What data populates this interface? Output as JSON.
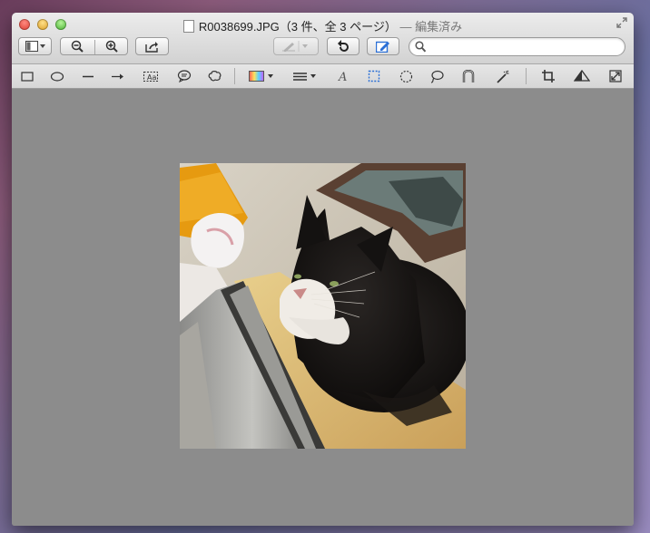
{
  "window": {
    "title_file": "R0038699.JPG",
    "title_count": "（3 件、全 3 ページ）",
    "title_status": "— 編集済み"
  },
  "toolbar": {
    "sidebar_button_icon": "sidebar-icon",
    "zoom_out_icon": "zoom-out-icon",
    "zoom_in_icon": "zoom-in-icon",
    "share_icon": "share-icon",
    "pen_icon": "pen-icon",
    "rotate_icon": "rotate-icon",
    "edit_icon": "edit-icon",
    "search_placeholder": ""
  },
  "annotation_tools": [
    "rectangle-icon",
    "oval-icon",
    "line-icon",
    "arrow-icon",
    "text-box-icon",
    "speech-bubble-icon",
    "thought-bubble-icon",
    "color-icon",
    "line-weight-icon",
    "font-icon",
    "rect-select-icon",
    "ellipse-select-icon",
    "lasso-icon",
    "smart-lasso-icon",
    "instant-alpha-icon",
    "crop-icon",
    "adjust-color-icon",
    "adjust-size-icon"
  ],
  "colors": {
    "canvas": "#8c8c8c",
    "active_tool": "#2a6fd6"
  }
}
